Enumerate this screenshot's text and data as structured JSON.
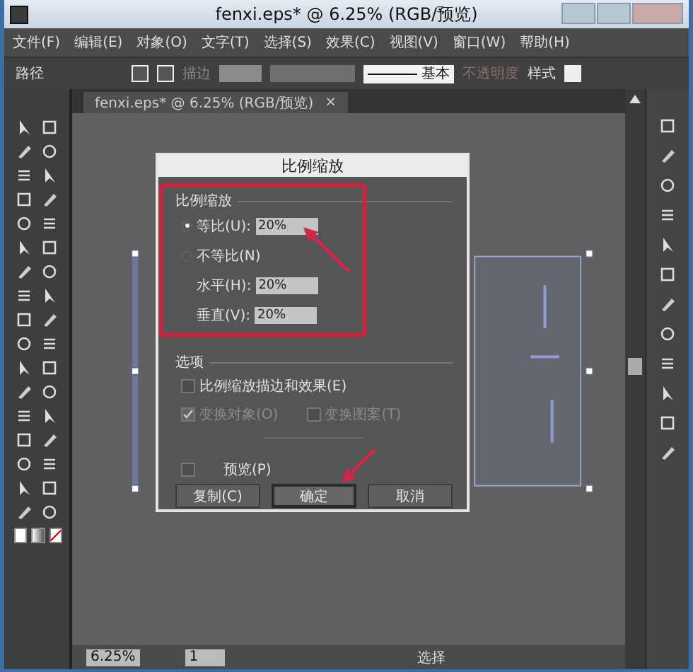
{
  "window": {
    "title": "fenxi.eps* @ 6.25% (RGB/预览)"
  },
  "menu": [
    "文件(F)",
    "编辑(E)",
    "对象(O)",
    "文字(T)",
    "选择(S)",
    "效果(C)",
    "视图(V)",
    "窗口(W)",
    "帮助(H)"
  ],
  "control_bar": {
    "selection": "路径",
    "stroke": {
      "label": "描边",
      "disabled": true
    },
    "brush": "基本",
    "opacity": {
      "label": "不透明度",
      "disabled": true
    },
    "style": "样式"
  },
  "document_tab": {
    "title": "fenxi.eps* @ 6.25% (RGB/预览)",
    "close": "×"
  },
  "dialog": {
    "title": "比例缩放",
    "scale_group": "比例缩放",
    "uniform": {
      "label": "等比(U):",
      "value": "20%",
      "selected": true
    },
    "non_uniform": {
      "label": "不等比(N)",
      "selected": false
    },
    "horizontal": {
      "label": "水平(H):",
      "value": "20%"
    },
    "vertical": {
      "label": "垂直(V):",
      "value": "20%"
    },
    "options_label": "选项",
    "options": [
      {
        "label": "比例缩放描边和效果(E)",
        "checked": false,
        "disabled": false
      },
      {
        "label": "变换对象(O)",
        "checked": true,
        "disabled": true
      },
      {
        "label": "变换图案(T)",
        "checked": false,
        "disabled": true
      }
    ],
    "preview": {
      "label": "预览(P)",
      "checked": false
    },
    "buttons": [
      {
        "label": "复制(C)",
        "default": false
      },
      {
        "label": "确定",
        "default": true
      },
      {
        "label": "取消",
        "default": false
      }
    ]
  },
  "status_bar": {
    "zoom": "6.25%",
    "artboard": "1",
    "tool": "选择"
  }
}
